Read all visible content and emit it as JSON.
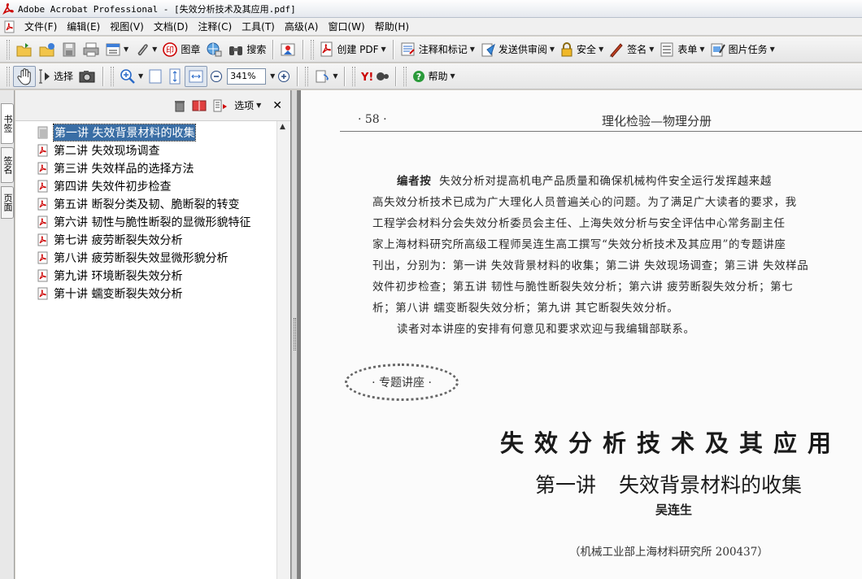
{
  "window": {
    "title": "Adobe Acrobat Professional - [失效分析技术及其应用.pdf]"
  },
  "menu": [
    "文件(F)",
    "编辑(E)",
    "视图(V)",
    "文档(D)",
    "注释(C)",
    "工具(T)",
    "高级(A)",
    "窗口(W)",
    "帮助(H)"
  ],
  "toolbar1": {
    "stamp": "图章",
    "search": "搜索",
    "create_pdf": "创建 PDF",
    "comment": "注释和标记",
    "send_review": "发送供审阅",
    "security": "安全",
    "sign": "签名",
    "forms": "表单",
    "picture_tasks": "图片任务"
  },
  "toolbar2": {
    "select": "选择",
    "zoom": "341%",
    "help": "帮助"
  },
  "nav_tabs": [
    "书签",
    "签名",
    "页面"
  ],
  "bookmarks": {
    "options_label": "选项",
    "items": [
      "第一讲  失效背景材料的收集",
      "第二讲  失效现场调查",
      "第三讲  失效样品的选择方法",
      "第四讲  失效件初步检查",
      "第五讲  断裂分类及韧、脆断裂的转变",
      "第六讲  韧性与脆性断裂的显微形貌特征",
      "第七讲  疲劳断裂失效分析",
      "第八讲  疲劳断裂失效显微形貌分析",
      "第九讲  环境断裂失效分析",
      "第十讲  蠕变断裂失效分析"
    ]
  },
  "page": {
    "page_number": "· 58 ·",
    "running_head": "理化检验—物理分册",
    "editor_label": "编者按",
    "lines": [
      "失效分析对提高机电产品质量和确保机械构件安全运行发挥越来越",
      "高失效分析技术已成为广大理化人员普遍关心的问题。为了满足广大读者的要求，我",
      "工程学会材料分会失效分析委员会主任、上海失效分析与安全评估中心常务副主任",
      "家上海材料研究所高级工程师吴连生高工撰写“失效分析技术及其应用”的专题讲座",
      "刊出，分别为：第一讲 失效背景材料的收集；第二讲 失效现场调查；第三讲 失效样品",
      "效件初步检查；第五讲 韧性与脆性断裂失效分析；第六讲 疲劳断裂失效分析；第七",
      "析；第八讲 蠕变断裂失效分析；第九讲 其它断裂失效分析。",
      "读者对本讲座的安排有何意见和要求欢迎与我编辑部联系。"
    ],
    "stamp_text": "· 专题讲座 ·",
    "main_title": "失效分析技术及其应用",
    "lecture_no": "第一讲",
    "lecture_title": "失效背景材料的收集",
    "author": "吴连生",
    "affiliation": "（机械工业部上海材料研究所   200437）"
  }
}
